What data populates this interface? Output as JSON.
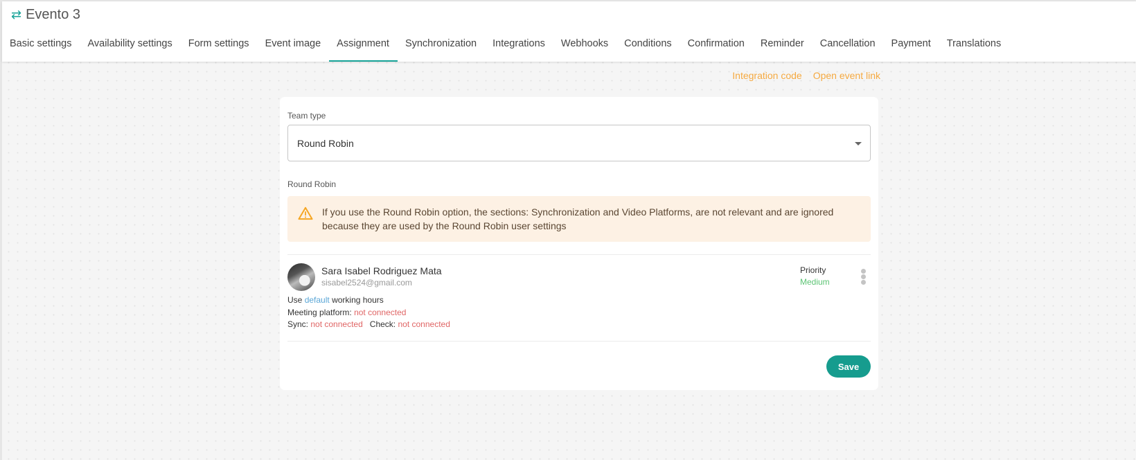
{
  "header": {
    "icon": "swap-arrows-icon",
    "title": "Evento 3"
  },
  "tabs": [
    {
      "label": "Basic settings",
      "active": false
    },
    {
      "label": "Availability settings",
      "active": false
    },
    {
      "label": "Form settings",
      "active": false
    },
    {
      "label": "Event image",
      "active": false
    },
    {
      "label": "Assignment",
      "active": true
    },
    {
      "label": "Synchronization",
      "active": false
    },
    {
      "label": "Integrations",
      "active": false
    },
    {
      "label": "Webhooks",
      "active": false
    },
    {
      "label": "Conditions",
      "active": false
    },
    {
      "label": "Confirmation",
      "active": false
    },
    {
      "label": "Reminder",
      "active": false
    },
    {
      "label": "Cancellation",
      "active": false
    },
    {
      "label": "Payment",
      "active": false
    },
    {
      "label": "Translations",
      "active": false
    }
  ],
  "links": {
    "integration_code": "Integration code",
    "open_event_link": "Open event link"
  },
  "form": {
    "team_type_label": "Team type",
    "team_type_value": "Round Robin",
    "section_label": "Round Robin",
    "alert_icon": "warning-triangle-icon",
    "alert_text": "If you use the Round Robin option, the sections: Synchronization and Video Platforms, are not relevant and are ignored because they are used by the Round Robin user settings"
  },
  "user": {
    "name": "Sara Isabel Rodriguez Mata",
    "email": "sisabel2524@gmail.com",
    "use_prefix": "Use",
    "use_link": "default",
    "use_suffix": "working hours",
    "meeting_label": "Meeting platform:",
    "meeting_status": "not connected",
    "sync_label": "Sync:",
    "sync_status": "not connected",
    "check_label": "Check:",
    "check_status": "not connected",
    "priority_label": "Priority",
    "priority_value": "Medium"
  },
  "actions": {
    "save_label": "Save"
  },
  "colors": {
    "accent": "#17a398",
    "link": "#f5a940",
    "alert_bg": "#fdf1e4",
    "error": "#e06666",
    "success": "#5cc474"
  }
}
